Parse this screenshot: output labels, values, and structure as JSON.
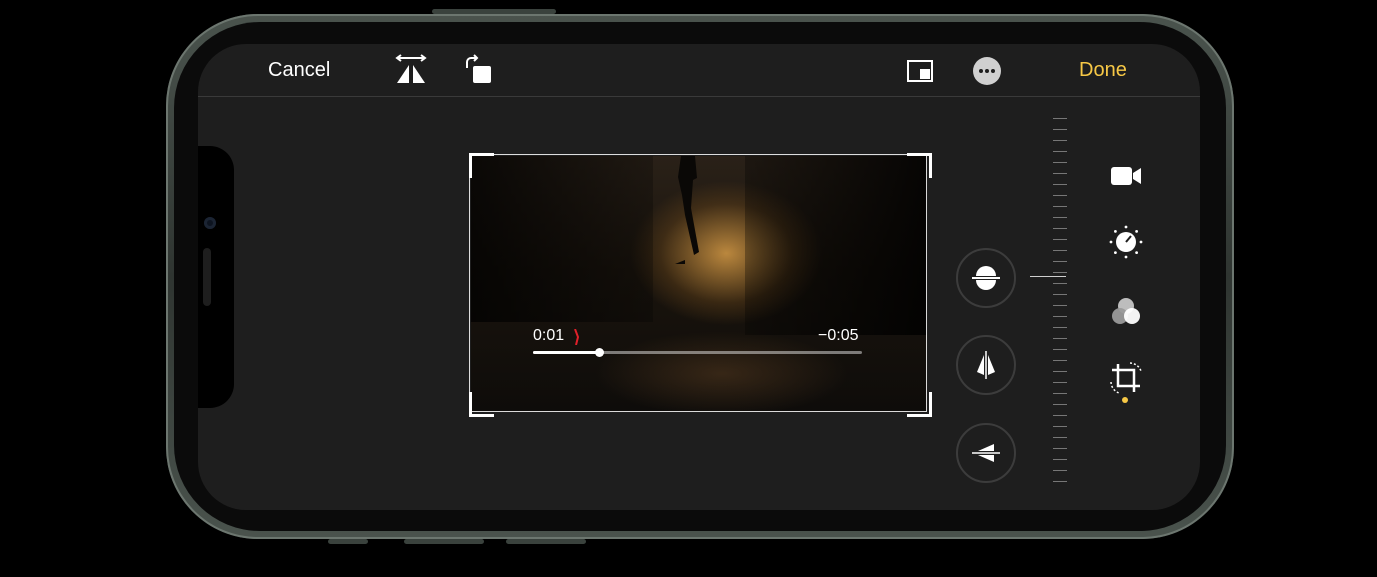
{
  "toolbar": {
    "cancel_label": "Cancel",
    "done_label": "Done",
    "icons": [
      "flip-icon",
      "rotate-icon",
      "aspect-ratio-icon",
      "more-icon"
    ]
  },
  "video": {
    "elapsed": "0:01",
    "remaining": "−0:05",
    "progress": 0.2
  },
  "adjust_buttons": [
    "straighten-icon",
    "vertical-perspective-icon",
    "horizontal-perspective-icon"
  ],
  "modes": [
    "video-camera-icon",
    "adjust-dial-icon",
    "filters-icon",
    "crop-rotate-icon"
  ],
  "colors": {
    "accent": "#f7c846",
    "background": "#1e1e1e"
  }
}
